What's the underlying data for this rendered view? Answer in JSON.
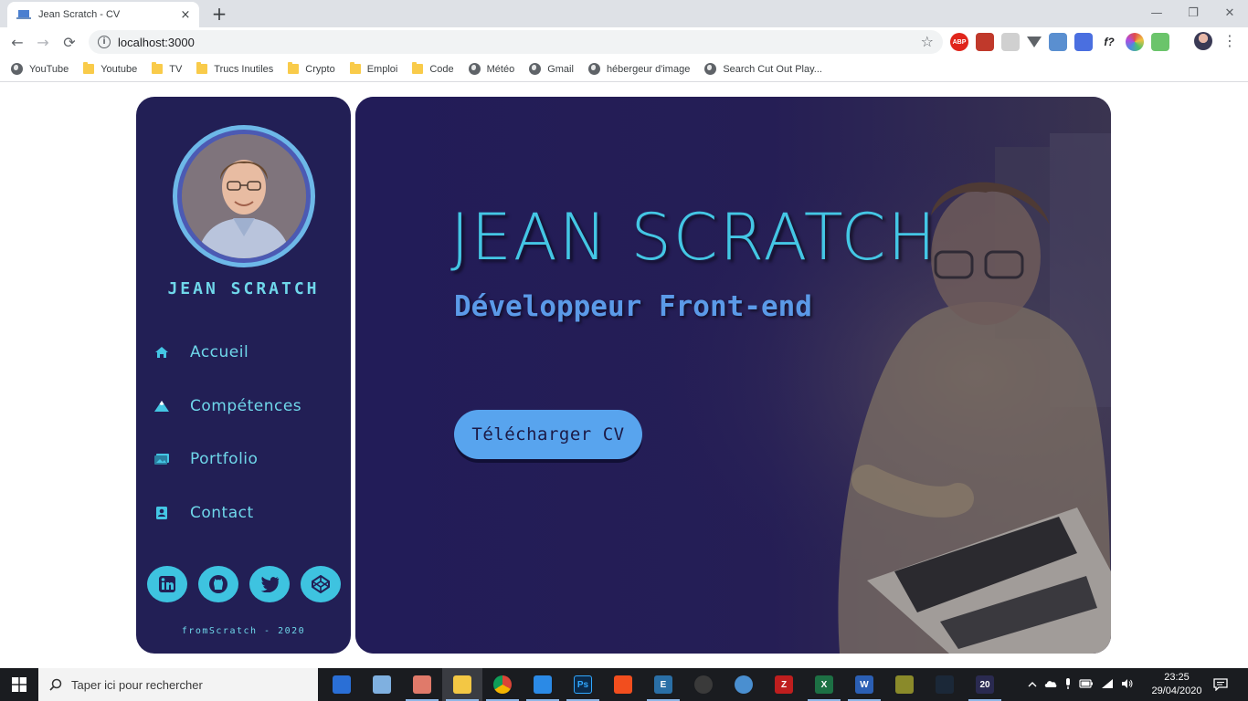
{
  "browser": {
    "tab_title": "Jean Scratch - CV",
    "tab_close": "×",
    "new_tab": "+",
    "window_controls": {
      "minimize": "—",
      "restore": "❐",
      "close": "✕"
    },
    "nav": {
      "back": "←",
      "forward": "→",
      "reload": "⟳"
    },
    "url": "localhost:3000",
    "star": "☆",
    "menu": "⋮",
    "extensions": [
      {
        "icon": "adblock-plus-icon",
        "text": "ABP",
        "color": "#e0261c"
      },
      {
        "icon": "red-extension-icon",
        "text": "",
        "color": "#c0392b"
      },
      {
        "icon": "ghost-extension-icon",
        "text": "",
        "color": "#d0d0d0"
      },
      {
        "icon": "vue-devtools-icon",
        "text": "",
        "color": "#5f6368"
      },
      {
        "icon": "blue-extension-icon",
        "text": "",
        "color": "#5a8fd0"
      },
      {
        "icon": "colorzilla-icon",
        "text": "",
        "color": "#4a6fe0"
      },
      {
        "icon": "font-identifier-icon",
        "text": "f?",
        "color": "#ffffff"
      },
      {
        "icon": "color-wheel-icon",
        "text": "",
        "color": "#e04c4c"
      },
      {
        "icon": "green-extension-icon",
        "text": "",
        "color": "#6bc46b"
      }
    ],
    "bookmarks": [
      {
        "label": "YouTube",
        "type": "globe"
      },
      {
        "label": "Youtube",
        "type": "folder"
      },
      {
        "label": "TV",
        "type": "folder"
      },
      {
        "label": "Trucs Inutiles",
        "type": "folder"
      },
      {
        "label": "Crypto",
        "type": "folder"
      },
      {
        "label": "Emploi",
        "type": "folder"
      },
      {
        "label": "Code",
        "type": "folder"
      },
      {
        "label": "Météo",
        "type": "globe"
      },
      {
        "label": "Gmail",
        "type": "globe"
      },
      {
        "label": "hébergeur d'image",
        "type": "globe"
      },
      {
        "label": "Search Cut Out Play...",
        "type": "globe"
      }
    ]
  },
  "sidebar": {
    "name": "JEAN SCRATCH",
    "nav": [
      {
        "label": "Accueil",
        "icon": "home-icon"
      },
      {
        "label": "Compétences",
        "icon": "mountain-icon"
      },
      {
        "label": "Portfolio",
        "icon": "images-icon"
      },
      {
        "label": "Contact",
        "icon": "contact-card-icon"
      }
    ],
    "socials": [
      {
        "name": "linkedin",
        "icon": "linkedin-icon"
      },
      {
        "name": "github",
        "icon": "github-icon"
      },
      {
        "name": "twitter",
        "icon": "twitter-icon"
      },
      {
        "name": "codepen",
        "icon": "codepen-icon"
      }
    ],
    "footer": "fromScratch - 2020"
  },
  "hero": {
    "title": "JEAN SCRATCH",
    "subtitle": "Développeur Front-end",
    "cta_label": "Télécharger CV"
  },
  "colors": {
    "panel_bg": "#221f55",
    "accent_cyan": "#6fd7ea",
    "title_cyan": "#44c6e4",
    "subtitle_blue": "#5b9ae8",
    "button_blue": "#58a4ee",
    "social_circle": "#3ec3e0"
  },
  "taskbar": {
    "search_placeholder": "Taper ici pour rechercher",
    "time": "23:25",
    "date": "29/04/2020",
    "apps": [
      {
        "icon": "shield-app-icon",
        "text": "",
        "color": "#2a6fd6"
      },
      {
        "icon": "notepad-app-icon",
        "text": "",
        "color": "#7fb0e0"
      },
      {
        "icon": "paint-app-icon",
        "text": "",
        "color": "#e07a6a"
      },
      {
        "icon": "file-explorer-icon",
        "text": "",
        "color": "#f3c744"
      },
      {
        "icon": "chrome-icon",
        "text": "",
        "color": "#d44a3a"
      },
      {
        "icon": "vscode-icon",
        "text": "",
        "color": "#2b8ae6"
      },
      {
        "icon": "photoshop-icon",
        "text": "Ps",
        "color": "#0b2a4a"
      },
      {
        "icon": "figma-icon",
        "text": "",
        "color": "#f24e1e"
      },
      {
        "icon": "editor-app-icon",
        "text": "E",
        "color": "#2a6fa6"
      },
      {
        "icon": "obs-icon",
        "text": "",
        "color": "#3a3a3a"
      },
      {
        "icon": "globe-app-icon",
        "text": "",
        "color": "#4a8fd0"
      },
      {
        "icon": "filezilla-icon",
        "text": "Z",
        "color": "#bf1e1e"
      },
      {
        "icon": "excel-icon",
        "text": "X",
        "color": "#1d7044"
      },
      {
        "icon": "word-icon",
        "text": "W",
        "color": "#2b5fb4"
      },
      {
        "icon": "winrar-icon",
        "text": "",
        "color": "#8a8a2a"
      },
      {
        "icon": "steam-icon",
        "text": "",
        "color": "#1b2838"
      },
      {
        "icon": "app-20-icon",
        "text": "20",
        "color": "#2a2a50"
      }
    ]
  }
}
